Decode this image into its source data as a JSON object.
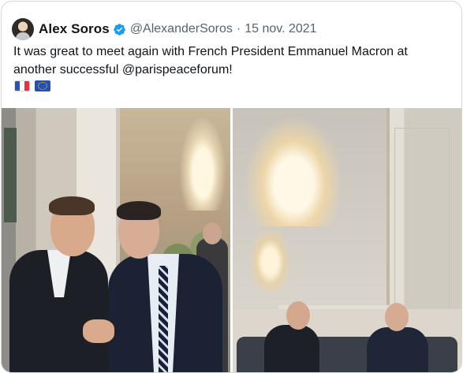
{
  "tweet": {
    "author_name": "Alex Soros",
    "handle": "@AlexanderSoros",
    "separator": "·",
    "date": "15 nov. 2021",
    "text": "It was great to meet again with French President Emmanuel Macron at another successful @parispeaceforum!",
    "flags": [
      "french-flag",
      "eu-flag"
    ],
    "verified_color": "#1d9bf0"
  },
  "media": [
    {
      "name": "photo-handshake"
    },
    {
      "name": "photo-seated-conversation"
    }
  ]
}
